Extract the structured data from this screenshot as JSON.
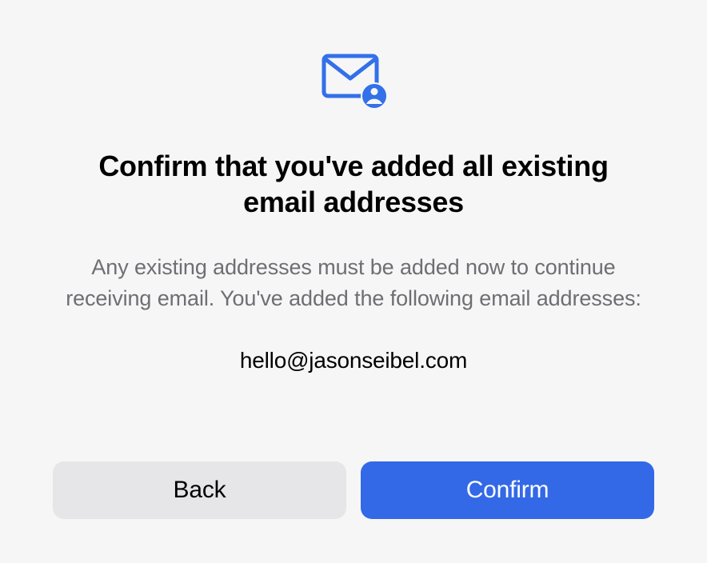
{
  "dialog": {
    "title": "Confirm that you've added all existing email addresses",
    "description": "Any existing addresses must be added now to continue receiving email. You've added the following email addresses:",
    "emails": [
      "hello@jasonseibel.com"
    ]
  },
  "buttons": {
    "back": "Back",
    "confirm": "Confirm"
  },
  "colors": {
    "accent": "#3369e7"
  }
}
